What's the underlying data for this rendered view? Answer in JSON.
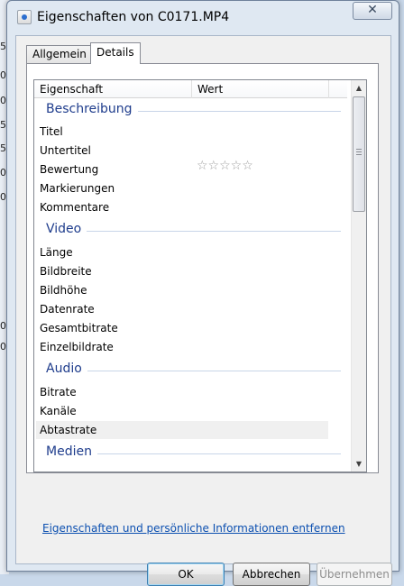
{
  "background": {
    "digits": [
      "5",
      "0",
      "0",
      "5",
      "5",
      "0",
      "0",
      "0",
      "0",
      "0"
    ]
  },
  "window": {
    "title": "Eigenschaften von C0171.MP4",
    "close_symbol": "✕"
  },
  "tabs": [
    {
      "label": "Allgemein",
      "selected": false
    },
    {
      "label": "Details",
      "selected": true
    }
  ],
  "list": {
    "columns": [
      "Eigenschaft",
      "Wert"
    ],
    "groups": {
      "description": "Beschreibung",
      "video": "Video",
      "audio": "Audio",
      "media": "Medien"
    },
    "description_props": [
      "Titel",
      "Untertitel",
      "Bewertung",
      "Markierungen",
      "Kommentare"
    ],
    "video_props": [
      "Länge",
      "Bildbreite",
      "Bildhöhe",
      "Datenrate",
      "Gesamtbitrate",
      "Einzelbildrate"
    ],
    "audio_props": [
      "Bitrate",
      "Kanäle",
      "Abtastrate"
    ],
    "rating_stars": "☆☆☆☆☆",
    "rating_value": 0,
    "selected_row": "Abtastrate"
  },
  "scrollbar": {
    "up": "▲",
    "down": "▼"
  },
  "link": "Eigenschaften und persönliche Informationen entfernen",
  "buttons": {
    "ok": "OK",
    "cancel": "Abbrechen",
    "apply": "Übernehmen"
  }
}
